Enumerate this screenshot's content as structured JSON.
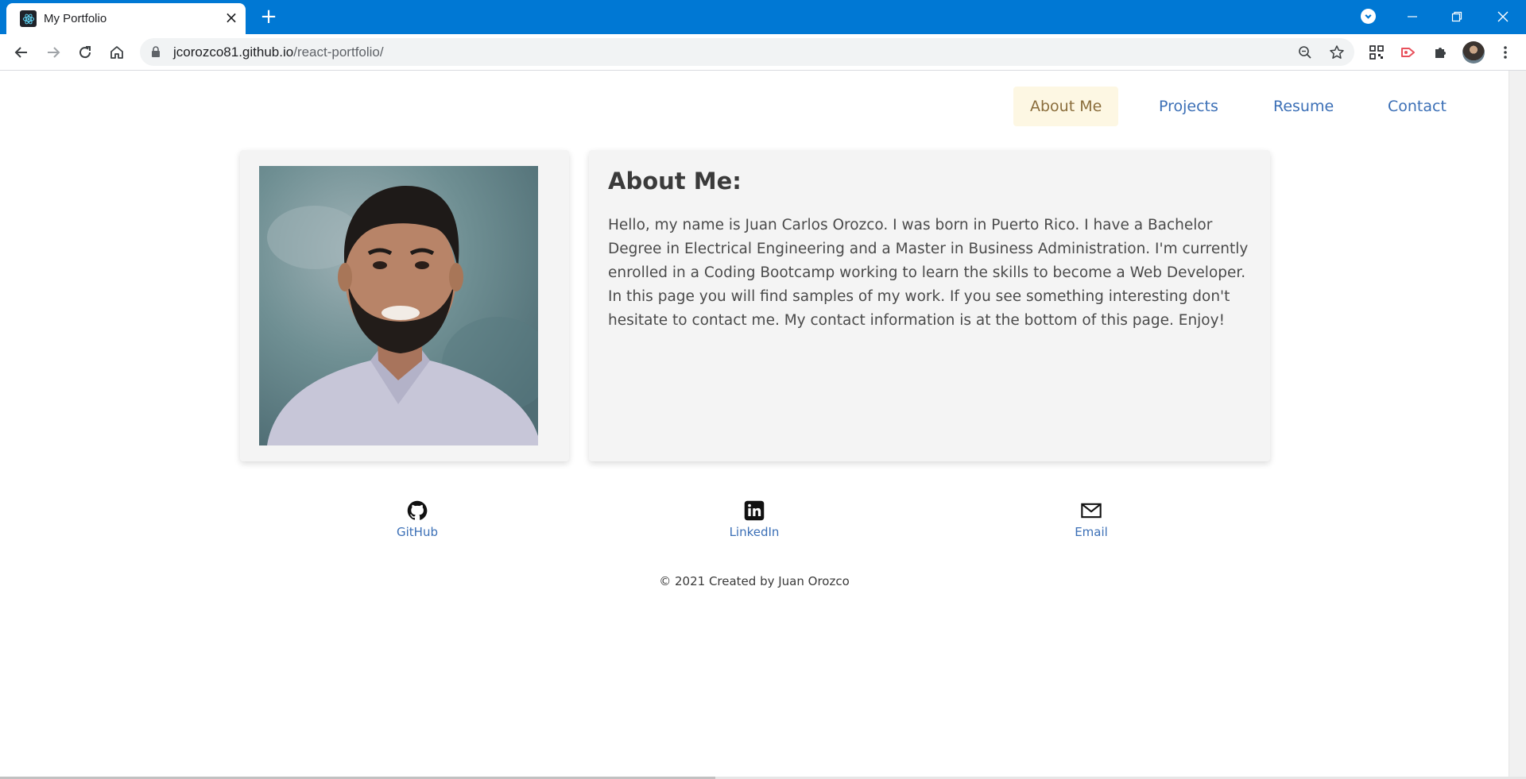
{
  "browser": {
    "tab_title": "My Portfolio",
    "url_host": "jcorozco81.github.io",
    "url_path": "/react-portfolio/",
    "chrome_color": "#0078d4"
  },
  "nav": {
    "links": [
      {
        "label": "About Me",
        "active": true
      },
      {
        "label": "Projects",
        "active": false
      },
      {
        "label": "Resume",
        "active": false
      },
      {
        "label": "Contact",
        "active": false
      }
    ]
  },
  "about": {
    "title": "About Me:",
    "body": "Hello, my name is Juan Carlos Orozco. I was born in Puerto Rico. I have a Bachelor Degree in Electrical Engineering and a Master in Business Administration. I'm currently enrolled in a Coding Bootcamp working to learn the skills to become a Web Developer. In this page you will find samples of my work. If you see something interesting don't hesitate to contact me. My contact information is at the bottom of this page. Enjoy!"
  },
  "social": [
    {
      "label": "GitHub",
      "icon": "github-icon"
    },
    {
      "label": "LinkedIn",
      "icon": "linkedin-icon"
    },
    {
      "label": "Email",
      "icon": "email-icon"
    }
  ],
  "footer": {
    "copyright": "© 2021 Created by Juan Orozco"
  },
  "colors": {
    "link": "#3b6fb6",
    "active_bg": "#fdf7e3",
    "active_text": "#8a6d3b",
    "card_bg": "#f4f4f4"
  }
}
